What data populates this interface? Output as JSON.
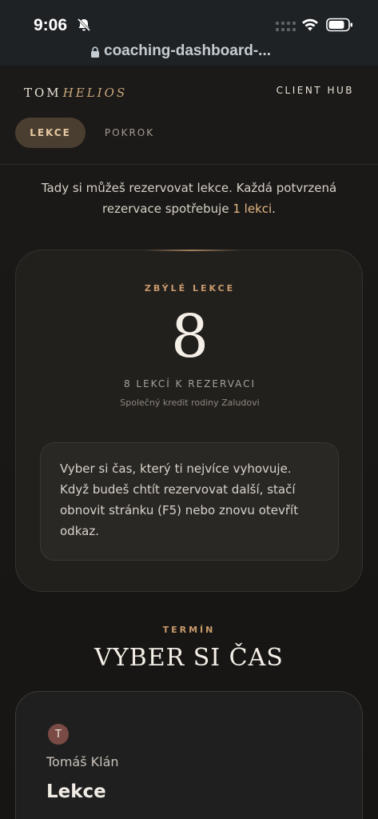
{
  "status_bar": {
    "time": "9:06"
  },
  "browser": {
    "url": "coaching-dashboard-..."
  },
  "header": {
    "brand_first": "TOM",
    "brand_second": "HELIOS",
    "client_hub": "CLIENT HUB"
  },
  "tabs": [
    {
      "label": "LEKCE",
      "active": true
    },
    {
      "label": "POKROK",
      "active": false
    }
  ],
  "intro": {
    "text_before": "Tady si můžeš rezervovat lekce. Každá potvrzená rezervace spotřebuje ",
    "highlight": "1 lekci",
    "text_after": "."
  },
  "credits": {
    "label": "ZBÝLÉ LEKCE",
    "count": "8",
    "summary": "8 LEKCÍ K REZERVACI",
    "note": "Společný kredit rodiny Zaludovi",
    "info": "Vyber si čas, který ti nejvíce vyhovuje. Když budeš chtít rezervovat další, stačí obnovit stránku (F5) nebo znovu otevřít odkaz."
  },
  "term": {
    "label": "TERMÍN",
    "heading": "VYBER SI ČAS"
  },
  "slot": {
    "avatar_initial": "T",
    "coach": "Tomáš Klán",
    "title": "Lekce"
  },
  "colors": {
    "accent": "#c99a6b",
    "tab_active_bg": "#4a3e31",
    "background": "#1a1816"
  }
}
